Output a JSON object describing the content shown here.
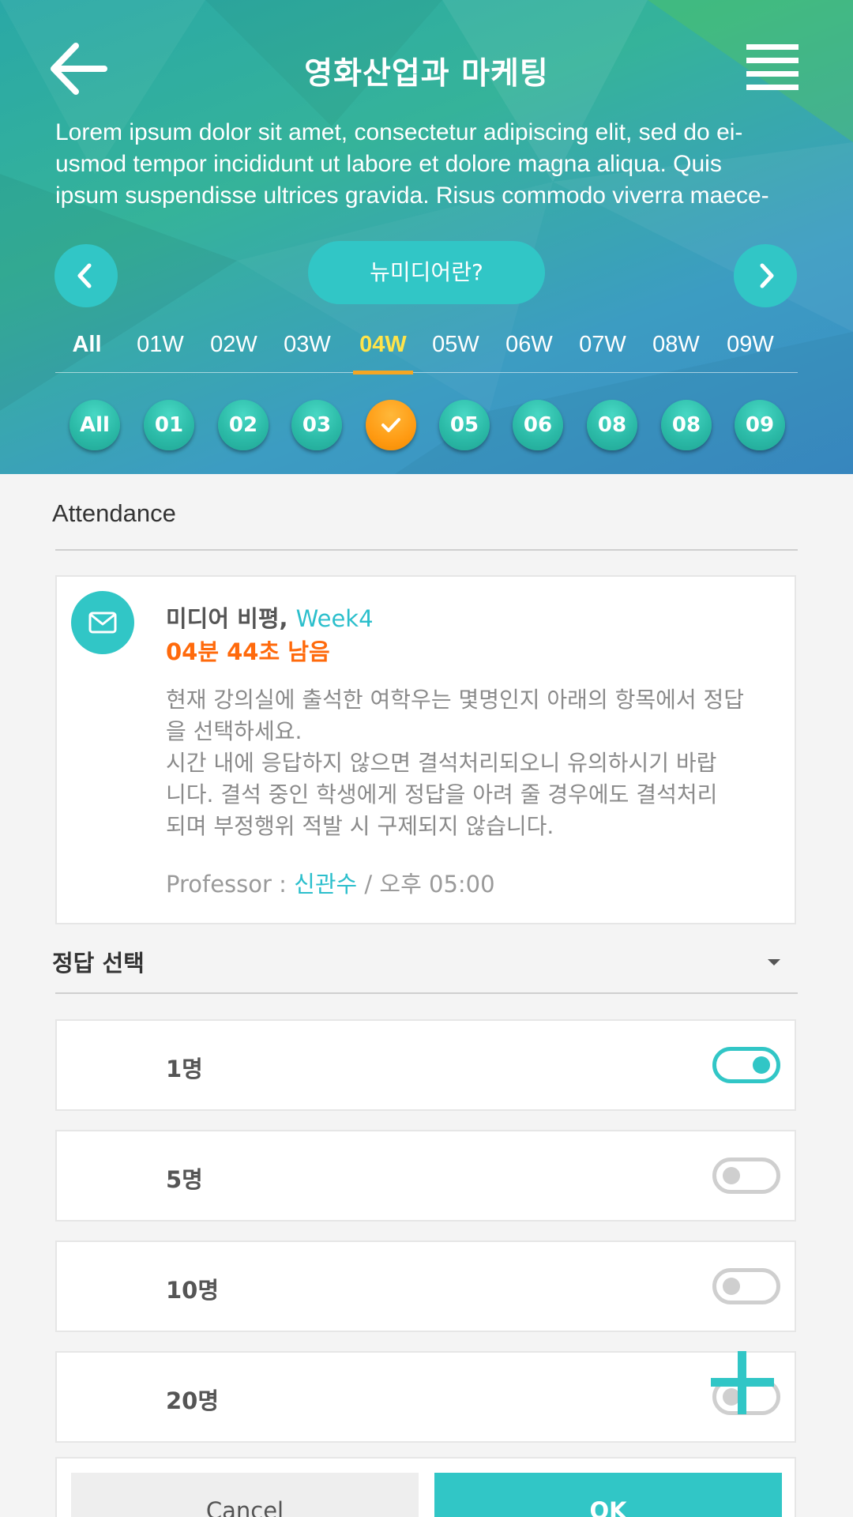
{
  "header": {
    "title": "영화산업과 마케팅",
    "description_lines": [
      "Lorem ipsum dolor sit amet, consectetur adipiscing elit, sed do ei-",
      "usmod tempor incididunt ut labore et dolore magna aliqua. Quis",
      "ipsum suspendisse ultrices gravida. Risus commodo viverra maece-"
    ],
    "topic_button": "뉴미디어란?",
    "icons": {
      "back": "arrow-left-icon",
      "menu": "hamburger-icon",
      "prev": "chevron-left-icon",
      "next": "chevron-right-icon"
    }
  },
  "weeks": {
    "tabs": [
      "All",
      "01W",
      "02W",
      "03W",
      "04W",
      "05W",
      "06W",
      "07W",
      "08W",
      "09W"
    ],
    "active": "04W",
    "bubbles": [
      "All",
      "01",
      "02",
      "03",
      "",
      "05",
      "06",
      "08",
      "08",
      "09"
    ],
    "completed_index": 4
  },
  "attendance": {
    "section_title": "Attendance",
    "card": {
      "course": "미디어 비평,",
      "week": "Week4",
      "timer": "04분 44초 남음",
      "body_lines": [
        "현재 강의실에 출석한 여학우는 몇명인지 아래의 항목에서 정답",
        "을 선택하세요.",
        "시간 내에 응답하지 않으면 결석처리되오니 유의하시기 바랍",
        "니다. 결석 중인 학생에게 정답을 아려 줄 경우에도 결석처리",
        "되며 부정행위 적발 시 구제되지 않습니다."
      ],
      "professor_label": "Professor :",
      "professor_name": "신관수",
      "time": "/ 오후 05:00"
    }
  },
  "answer": {
    "label": "정답 선택",
    "options": [
      {
        "label": "1명",
        "selected": true
      },
      {
        "label": "5명",
        "selected": false
      },
      {
        "label": "10명",
        "selected": false
      },
      {
        "label": "20명",
        "selected": false
      }
    ]
  },
  "actions": {
    "cancel": "Cancel",
    "ok": "OK"
  },
  "colors": {
    "accent": "#31c6c6",
    "orange": "#ff9b13",
    "timer": "#ff6a0c",
    "active_tab": "#ffe44a"
  }
}
